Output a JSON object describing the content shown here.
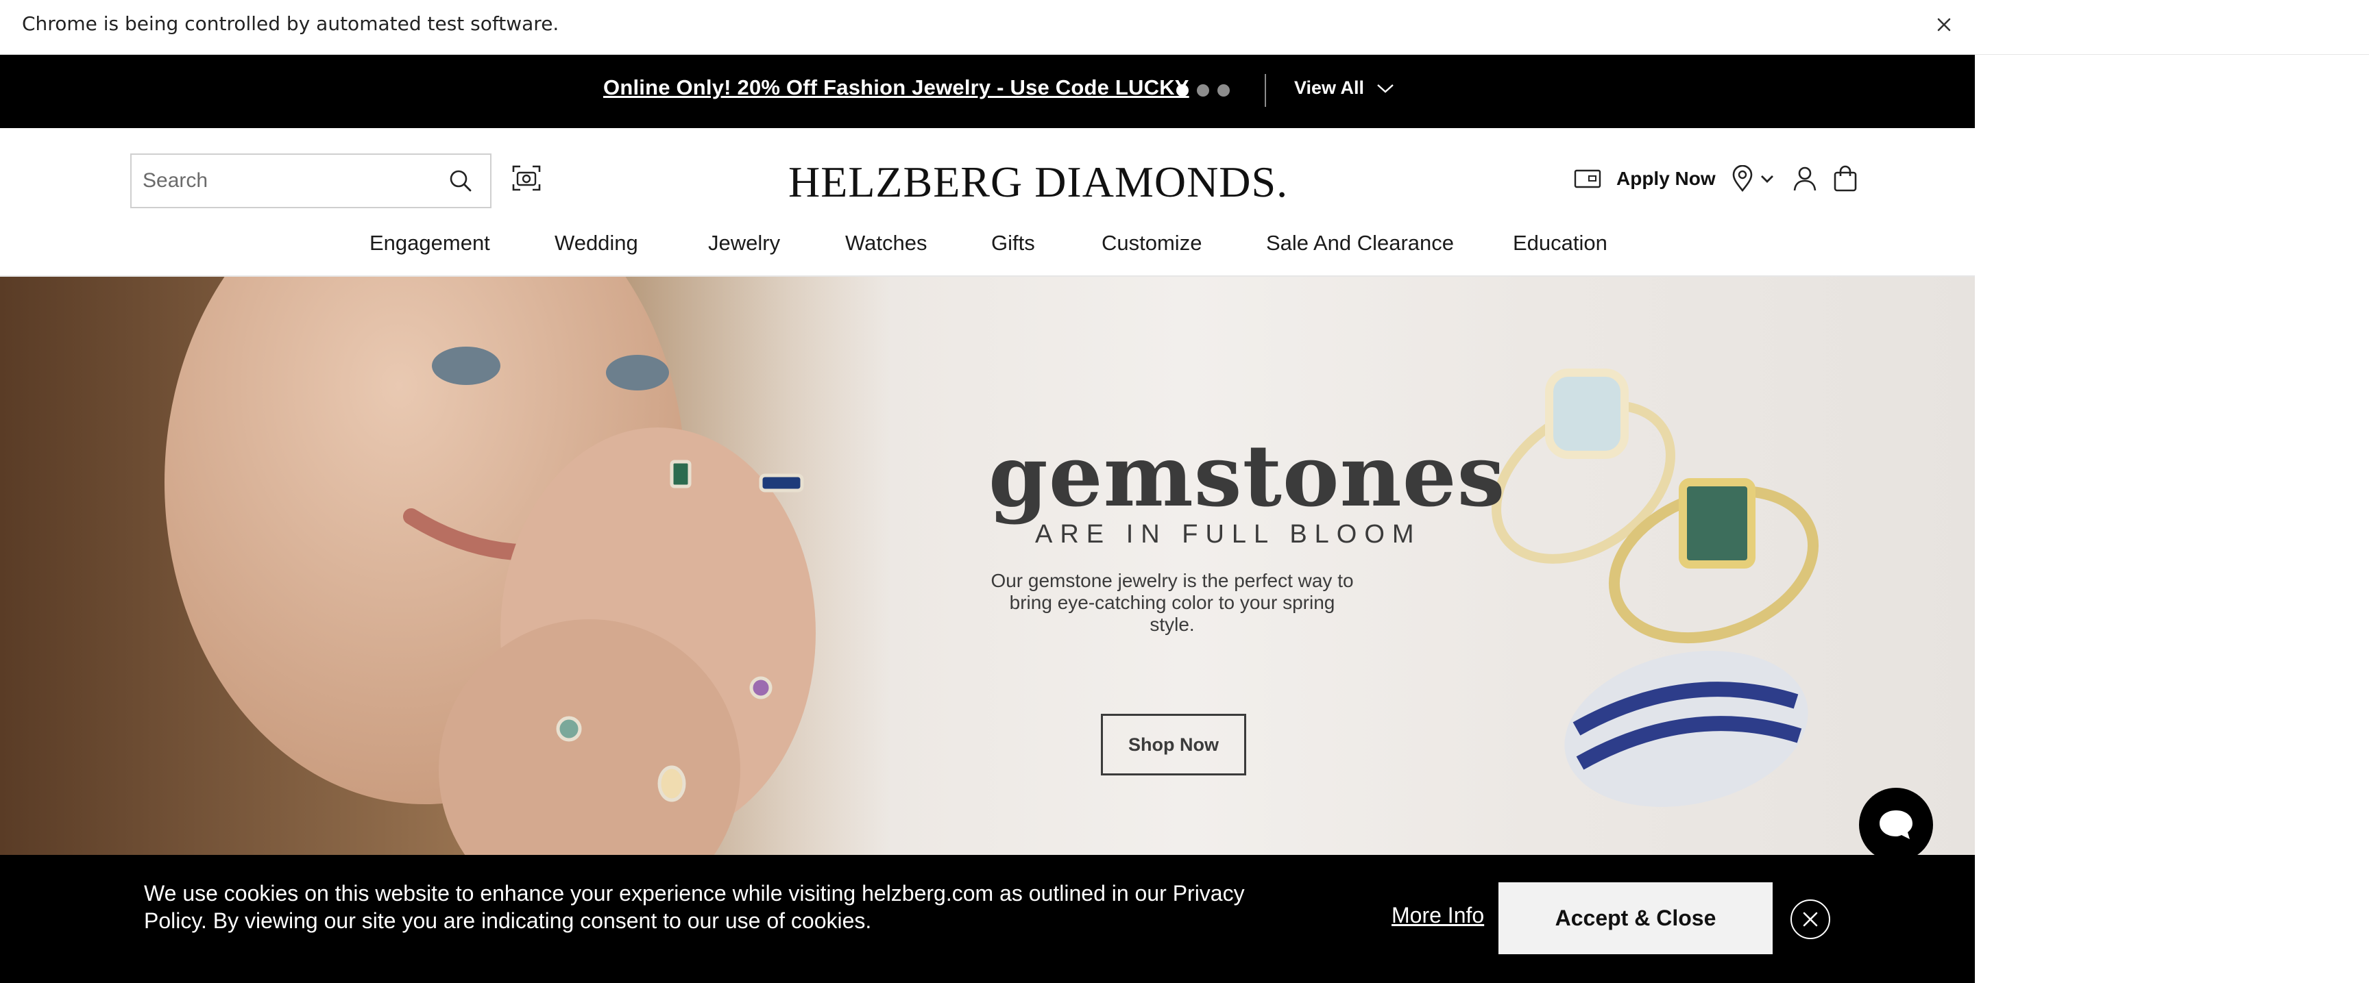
{
  "browser": {
    "infobar_text": "Chrome is being controlled by automated test software.",
    "close_glyph": "✕"
  },
  "promo": {
    "text": "Online Only! 20% Off Fashion Jewelry - Use Code LUCKY",
    "slide_count": 3,
    "active_slide": 1,
    "view_all": "View All"
  },
  "header": {
    "search_placeholder": "Search",
    "logo": "HELZBERG DIAMONDS.",
    "apply_now": "Apply Now",
    "icons": [
      "search-icon",
      "visual-search-icon",
      "credit-card-icon",
      "location-pin-icon",
      "chevron-down-icon",
      "user-icon",
      "shopping-bag-icon"
    ]
  },
  "nav": {
    "items": [
      "Engagement",
      "Wedding",
      "Jewelry",
      "Watches",
      "Gifts",
      "Customize",
      "Sale And Clearance",
      "Education"
    ]
  },
  "hero": {
    "title": "gemstones",
    "subtitle": "ARE IN FULL BLOOM",
    "body": "Our gemstone jewelry is the perfect way to bring eye-catching color to your spring style.",
    "cta": "Shop Now"
  },
  "cookie": {
    "text": "We use cookies on this website to enhance your experience while visiting helzberg.com as outlined in our Privacy Policy. By viewing our site you are indicating consent to our use of cookies.",
    "more_info": "More Info",
    "accept": "Accept & Close"
  },
  "colors": {
    "promo_bg": "#000000",
    "cookie_bg": "#000000",
    "text_dark": "#1a1a1a",
    "hero_text": "#3b3b3b"
  }
}
